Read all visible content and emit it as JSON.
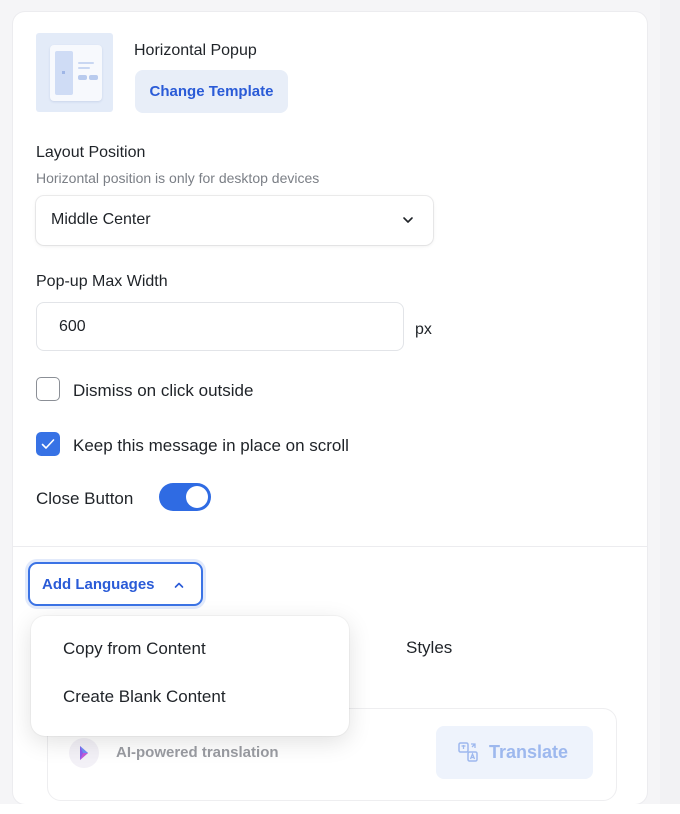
{
  "template": {
    "name": "Horizontal Popup",
    "change_label": "Change Template"
  },
  "layout_position": {
    "label": "Layout Position",
    "hint": "Horizontal position is only for desktop devices",
    "selected": "Middle Center"
  },
  "max_width": {
    "label": "Pop-up Max Width",
    "value": "600",
    "unit": "px"
  },
  "options": {
    "dismiss_label": "Dismiss on click outside",
    "dismiss_checked": false,
    "keep_label": "Keep this message in place on scroll",
    "keep_checked": true,
    "close_button_label": "Close Button",
    "close_button_on": true
  },
  "languages": {
    "add_label": "Add Languages",
    "menu": [
      "Copy from Content",
      "Create Blank Content"
    ],
    "styles_tab": "Styles",
    "ai_label": "AI-powered translation",
    "translate_label": "Translate"
  },
  "colors": {
    "accent": "#2f6be3",
    "accent_text": "#2a5bd7"
  }
}
